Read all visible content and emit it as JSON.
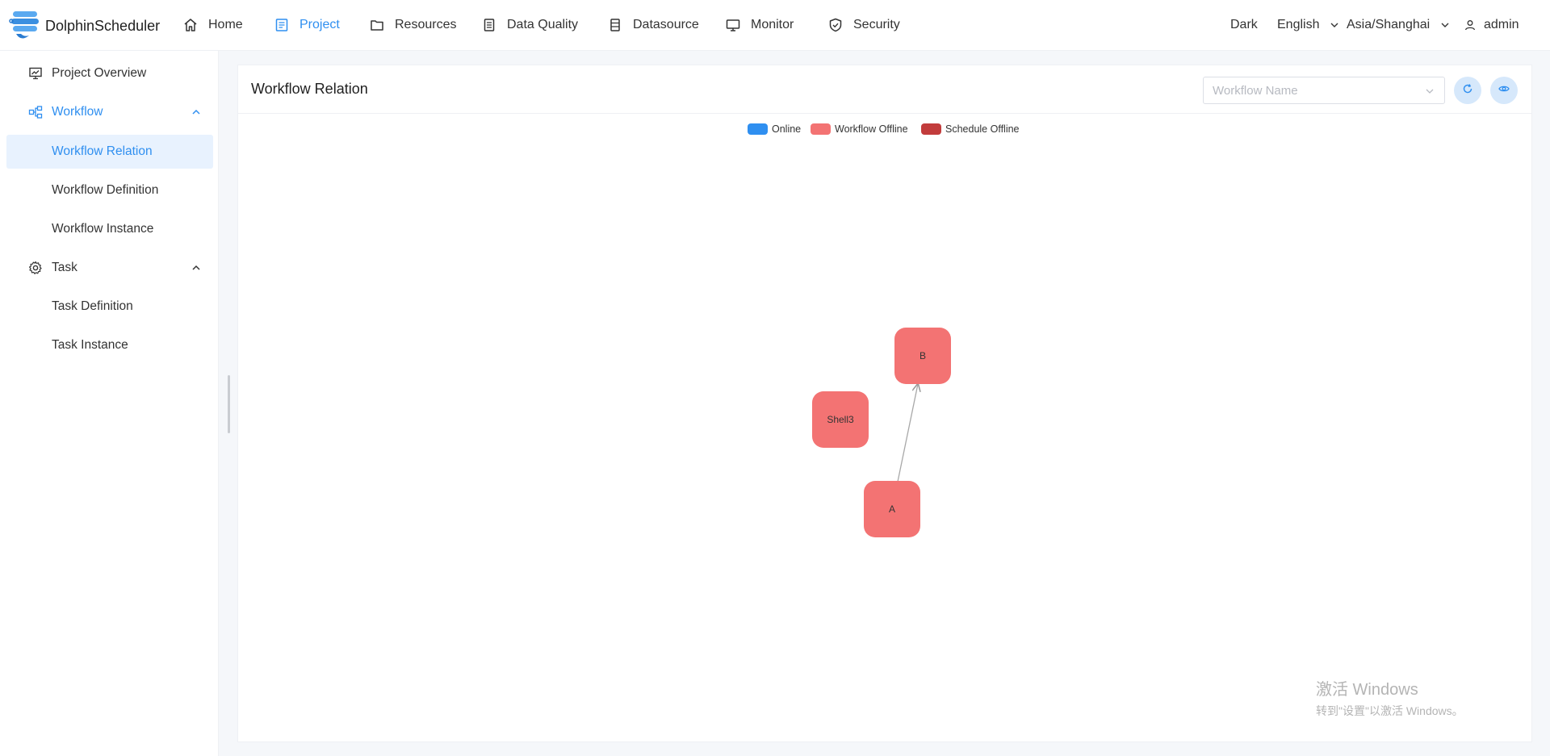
{
  "app": {
    "name": "DolphinScheduler"
  },
  "nav": [
    {
      "label": "Home",
      "icon": "home-icon"
    },
    {
      "label": "Project",
      "icon": "project-icon"
    },
    {
      "label": "Resources",
      "icon": "folder-icon"
    },
    {
      "label": "Data Quality",
      "icon": "document-icon"
    },
    {
      "label": "Datasource",
      "icon": "database-icon"
    },
    {
      "label": "Monitor",
      "icon": "monitor-icon"
    },
    {
      "label": "Security",
      "icon": "shield-icon"
    }
  ],
  "active_nav": "Project",
  "header_right": {
    "theme": "Dark",
    "language": "English",
    "timezone": "Asia/Shanghai",
    "user": "admin"
  },
  "sidebar": {
    "project_overview": "Project Overview",
    "workflow": "Workflow",
    "workflow_relation": "Workflow Relation",
    "workflow_definition": "Workflow Definition",
    "workflow_instance": "Workflow Instance",
    "task": "Task",
    "task_definition": "Task Definition",
    "task_instance": "Task Instance"
  },
  "card": {
    "title": "Workflow Relation",
    "select_placeholder": "Workflow Name"
  },
  "legend": [
    {
      "label": "Online",
      "color": "#2f8ff0"
    },
    {
      "label": "Workflow Offline",
      "color": "#f37373"
    },
    {
      "label": "Schedule Offline",
      "color": "#c23c3c"
    }
  ],
  "graph": {
    "nodes": [
      {
        "id": "B",
        "label": "B",
        "color": "#f37373"
      },
      {
        "id": "Shell3",
        "label": "Shell3",
        "color": "#f37373"
      },
      {
        "id": "A",
        "label": "A",
        "color": "#f37373"
      }
    ],
    "edges": [
      {
        "from": "A",
        "to": "B"
      }
    ]
  },
  "watermark": {
    "line1": "激活 Windows",
    "line2": "转到\"设置\"以激活 Windows。"
  }
}
